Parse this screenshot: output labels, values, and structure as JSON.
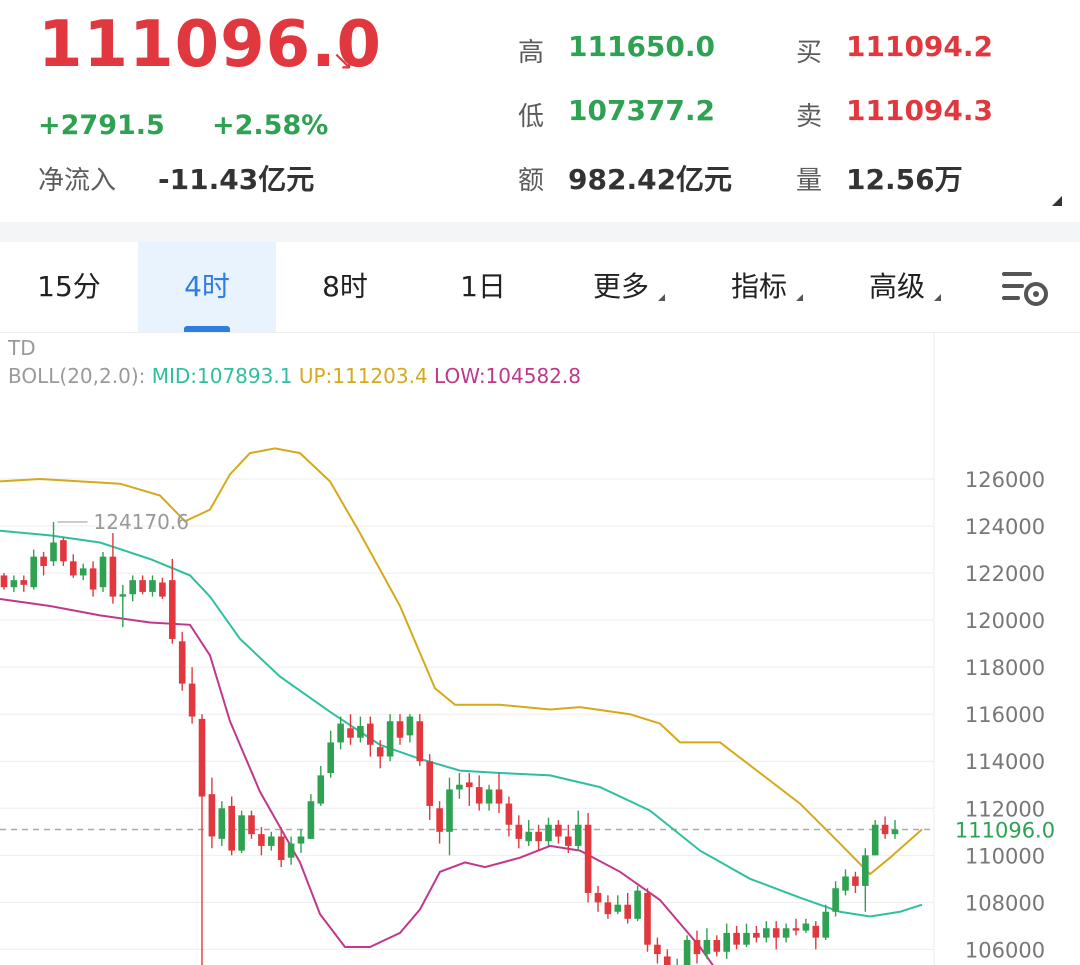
{
  "quote": {
    "price": "111096.0",
    "arrow": "↘",
    "change": "+2791.5",
    "change_pct": "+2.58%",
    "net_inflow_label": "净流入",
    "net_inflow": "-11.43亿元",
    "high_label": "高",
    "high": "111650.0",
    "low_label": "低",
    "low": "107377.2",
    "amount_label": "额",
    "amount": "982.42亿元",
    "bid_label": "买",
    "bid": "111094.2",
    "ask_label": "卖",
    "ask": "111094.3",
    "volume_label": "量",
    "volume": "12.56万"
  },
  "tabs": [
    {
      "label": "15分",
      "active": false,
      "dropdown": false
    },
    {
      "label": "4时",
      "active": true,
      "dropdown": false
    },
    {
      "label": "8时",
      "active": false,
      "dropdown": false
    },
    {
      "label": "1日",
      "active": false,
      "dropdown": false
    },
    {
      "label": "更多",
      "active": false,
      "dropdown": true
    },
    {
      "label": "指标",
      "active": false,
      "dropdown": true
    },
    {
      "label": "高级",
      "active": false,
      "dropdown": true
    }
  ],
  "indicator": {
    "name": "TD",
    "boll_label": "BOLL(20,2.0):",
    "mid": "MID:107893.1",
    "up": "UP:111203.4",
    "low": "LOW:104582.8"
  },
  "colors": {
    "up_candle": "#e0383e",
    "down_candle": "#2ea152",
    "mid_line": "#2fbfa0",
    "upper_band": "#d6a91a",
    "lower_band": "#c0388c",
    "grid": "#eeeeee",
    "price_line": "#aaaaaa"
  },
  "chart_data": {
    "type": "candlestick",
    "ylim": [
      105000,
      127000
    ],
    "y_ticks": [
      126000,
      124000,
      122000,
      120000,
      118000,
      116000,
      114000,
      112000,
      110000,
      108000,
      106000
    ],
    "current_price": 111096.0,
    "current_price_label": "111096.0",
    "max_annotation": {
      "value": 124170.6,
      "label": "124170.6"
    },
    "candles": [
      [
        121900,
        121400,
        122000,
        121300
      ],
      [
        121400,
        121700,
        121900,
        121200
      ],
      [
        121700,
        121500,
        121900,
        121200
      ],
      [
        121400,
        122700,
        123000,
        121300
      ],
      [
        122700,
        122300,
        122900,
        121900
      ],
      [
        122500,
        123300,
        124170.6,
        122300
      ],
      [
        123400,
        122500,
        123500,
        122300
      ],
      [
        122500,
        121900,
        122800,
        121800
      ],
      [
        121900,
        122200,
        122400,
        121700
      ],
      [
        122200,
        121300,
        122500,
        121000
      ],
      [
        121400,
        122700,
        122900,
        121200
      ],
      [
        122700,
        121000,
        123700,
        120700
      ],
      [
        121000,
        121100,
        121500,
        119700
      ],
      [
        121100,
        121700,
        121900,
        120800
      ],
      [
        121700,
        121200,
        121900,
        121100
      ],
      [
        121200,
        121700,
        121900,
        121000
      ],
      [
        121600,
        121000,
        121800,
        120900
      ],
      [
        121700,
        119200,
        122600,
        119000
      ],
      [
        119100,
        117300,
        119500,
        117000
      ],
      [
        117300,
        115900,
        118000,
        115600
      ],
      [
        115800,
        112500,
        116000,
        105000
      ],
      [
        112600,
        110800,
        113300,
        110300
      ],
      [
        110700,
        112000,
        112300,
        110400
      ],
      [
        112100,
        110200,
        112500,
        110000
      ],
      [
        110200,
        111700,
        111900,
        110100
      ],
      [
        111700,
        110900,
        111900,
        110700
      ],
      [
        110900,
        110400,
        111200,
        110000
      ],
      [
        110400,
        110800,
        111000,
        110200
      ],
      [
        110800,
        109800,
        111200,
        109500
      ],
      [
        109900,
        110500,
        110800,
        109600
      ],
      [
        110500,
        110800,
        111100,
        110100
      ],
      [
        110700,
        112300,
        112600,
        110700
      ],
      [
        112200,
        113400,
        113800,
        112100
      ],
      [
        113500,
        114800,
        115300,
        113300
      ],
      [
        114800,
        115600,
        115900,
        114500
      ],
      [
        115400,
        115000,
        116000,
        114700
      ],
      [
        115000,
        115500,
        115900,
        114800
      ],
      [
        115600,
        114700,
        115900,
        114200
      ],
      [
        114600,
        114200,
        114900,
        113700
      ],
      [
        114200,
        115700,
        116000,
        114000
      ],
      [
        115700,
        115000,
        116000,
        114700
      ],
      [
        115100,
        115900,
        116000,
        114800
      ],
      [
        115700,
        114000,
        116000,
        113800
      ],
      [
        114000,
        112100,
        114300,
        111500
      ],
      [
        112000,
        111000,
        112300,
        110500
      ],
      [
        111000,
        112800,
        113300,
        110000
      ],
      [
        112800,
        113000,
        113500,
        112400
      ],
      [
        113100,
        112900,
        113500,
        112100
      ],
      [
        112900,
        112200,
        113400,
        111900
      ],
      [
        112200,
        112800,
        113000,
        111900
      ],
      [
        112800,
        112200,
        113500,
        111800
      ],
      [
        112200,
        111300,
        112500,
        110800
      ],
      [
        111300,
        110700,
        111700,
        110300
      ],
      [
        110600,
        111000,
        111500,
        110400
      ],
      [
        111000,
        110600,
        111300,
        110200
      ],
      [
        110600,
        111300,
        111600,
        110400
      ],
      [
        111300,
        110800,
        111500,
        110500
      ],
      [
        110800,
        110400,
        111300,
        110100
      ],
      [
        110400,
        111300,
        111900,
        110200
      ],
      [
        111300,
        108400,
        111800,
        108000
      ],
      [
        108400,
        108000,
        108700,
        107600
      ],
      [
        108000,
        107500,
        108300,
        107300
      ],
      [
        107600,
        107900,
        108300,
        107500
      ],
      [
        107900,
        107300,
        108400,
        107100
      ],
      [
        107300,
        108500,
        108700,
        107200
      ],
      [
        108400,
        106200,
        108600,
        105900
      ],
      [
        106200,
        105800,
        106500,
        105400
      ],
      [
        105700,
        104800,
        106000,
        104500
      ],
      [
        104800,
        105300,
        105600,
        104300
      ],
      [
        105300,
        106400,
        106600,
        105100
      ],
      [
        106400,
        105800,
        106800,
        105400
      ],
      [
        105800,
        106400,
        106900,
        105600
      ],
      [
        106400,
        105900,
        106600,
        105700
      ],
      [
        105900,
        106700,
        107100,
        105600
      ],
      [
        106700,
        106200,
        107000,
        106000
      ],
      [
        106200,
        106700,
        107100,
        106100
      ],
      [
        106700,
        106500,
        107000,
        106300
      ],
      [
        106500,
        106900,
        107200,
        106300
      ],
      [
        106900,
        106500,
        107200,
        106000
      ],
      [
        106500,
        106900,
        107100,
        106300
      ],
      [
        106900,
        106800,
        107300,
        106600
      ],
      [
        106800,
        107100,
        107300,
        106700
      ],
      [
        107000,
        106500,
        107200,
        106000
      ],
      [
        106500,
        107600,
        107900,
        106400
      ],
      [
        107600,
        108600,
        108900,
        107400
      ],
      [
        108500,
        109100,
        109400,
        108300
      ],
      [
        109100,
        108700,
        109300,
        108400
      ],
      [
        108700,
        110000,
        110300,
        107600
      ],
      [
        110000,
        111300,
        111500,
        110000
      ],
      [
        111300,
        110900,
        111650,
        110700
      ],
      [
        110900,
        111096,
        111500,
        110700
      ]
    ],
    "mid_band": [
      [
        0,
        123800
      ],
      [
        50,
        123600
      ],
      [
        100,
        123300
      ],
      [
        150,
        122600
      ],
      [
        190,
        121900
      ],
      [
        210,
        121000
      ],
      [
        240,
        119200
      ],
      [
        280,
        117600
      ],
      [
        330,
        116100
      ],
      [
        380,
        114700
      ],
      [
        420,
        114100
      ],
      [
        460,
        113600
      ],
      [
        500,
        113500
      ],
      [
        550,
        113400
      ],
      [
        600,
        112900
      ],
      [
        650,
        111900
      ],
      [
        700,
        110200
      ],
      [
        750,
        109000
      ],
      [
        800,
        108200
      ],
      [
        840,
        107600
      ],
      [
        870,
        107400
      ],
      [
        900,
        107600
      ],
      [
        922,
        107900
      ]
    ],
    "upper_band": [
      [
        0,
        125900
      ],
      [
        40,
        126000
      ],
      [
        80,
        125900
      ],
      [
        120,
        125800
      ],
      [
        160,
        125300
      ],
      [
        185,
        124200
      ],
      [
        210,
        124700
      ],
      [
        230,
        126200
      ],
      [
        250,
        127100
      ],
      [
        275,
        127300
      ],
      [
        300,
        127100
      ],
      [
        330,
        125900
      ],
      [
        360,
        123700
      ],
      [
        400,
        120600
      ],
      [
        435,
        117100
      ],
      [
        455,
        116400
      ],
      [
        500,
        116400
      ],
      [
        550,
        116200
      ],
      [
        580,
        116300
      ],
      [
        630,
        116000
      ],
      [
        660,
        115600
      ],
      [
        680,
        114800
      ],
      [
        720,
        114800
      ],
      [
        760,
        113500
      ],
      [
        800,
        112200
      ],
      [
        840,
        110500
      ],
      [
        870,
        109200
      ],
      [
        890,
        109900
      ],
      [
        922,
        111100
      ]
    ],
    "lower_band": [
      [
        0,
        120900
      ],
      [
        50,
        120600
      ],
      [
        100,
        120200
      ],
      [
        150,
        119900
      ],
      [
        190,
        119800
      ],
      [
        210,
        118500
      ],
      [
        230,
        115700
      ],
      [
        260,
        112700
      ],
      [
        300,
        109700
      ],
      [
        320,
        107500
      ],
      [
        345,
        106100
      ],
      [
        370,
        106100
      ],
      [
        400,
        106700
      ],
      [
        420,
        107700
      ],
      [
        440,
        109300
      ],
      [
        465,
        109700
      ],
      [
        485,
        109500
      ],
      [
        520,
        109900
      ],
      [
        550,
        110400
      ],
      [
        580,
        110200
      ],
      [
        620,
        109300
      ],
      [
        660,
        108100
      ],
      [
        700,
        106100
      ],
      [
        720,
        104900
      ]
    ]
  }
}
